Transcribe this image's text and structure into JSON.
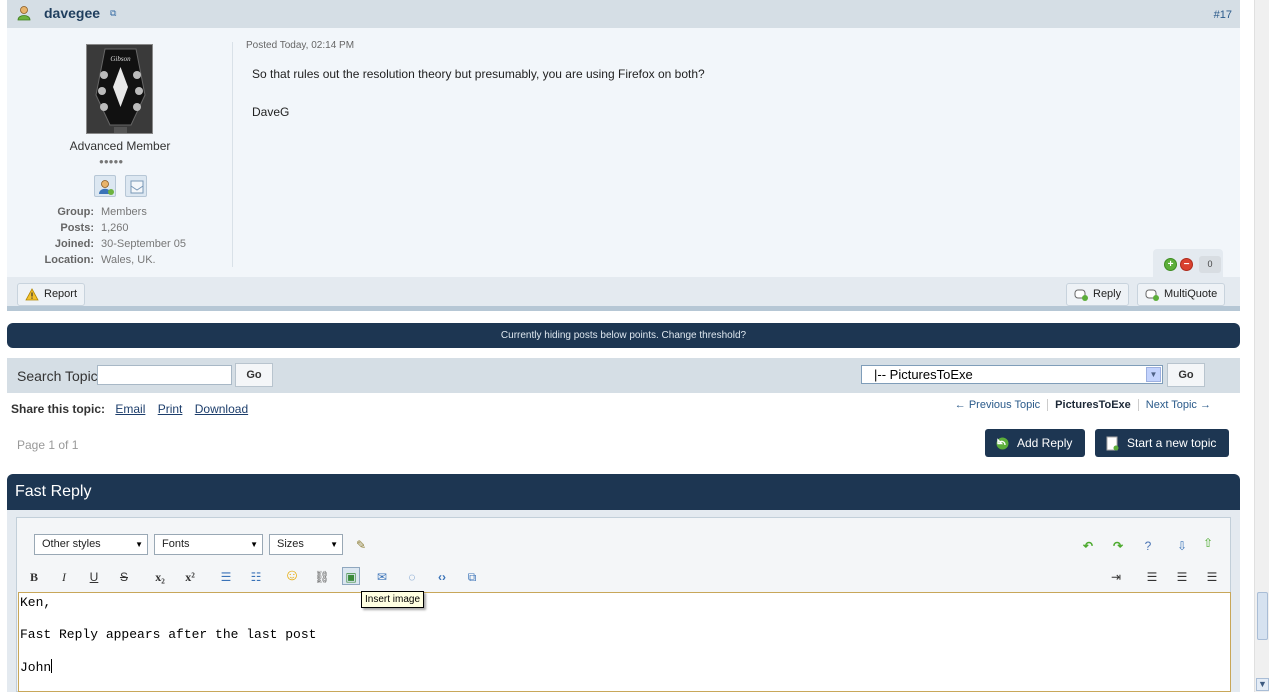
{
  "post": {
    "username": "davegee",
    "post_number": "#17",
    "posted": "Posted Today, 02:14 PM",
    "body_lines": [
      "So that rules out the resolution theory but presumably, you are using Firefox on both?",
      "DaveG"
    ],
    "author": {
      "title": "Advanced Member",
      "pips": "●●●●●",
      "meta": [
        {
          "k": "Group:",
          "v": "Members"
        },
        {
          "k": "Posts:",
          "v": "1,260"
        },
        {
          "k": "Joined:",
          "v": "30-September 05"
        },
        {
          "k": "Location:",
          "v": "Wales, UK."
        }
      ]
    },
    "rep_count": "0",
    "report_label": "Report",
    "reply_label": "Reply",
    "multiquote_label": "MultiQuote"
  },
  "threshold_text": "Currently hiding posts below points. Change threshold?",
  "topic_bar": {
    "search_label": "Search Topic",
    "search_value": "",
    "go_label": "Go",
    "forum_select": "|-- PicturesToExe"
  },
  "share": {
    "label": "Share this topic:",
    "links": [
      "Email",
      "Print",
      "Download"
    ]
  },
  "topic_nav": {
    "prev": "← Previous Topic",
    "current": "PicturesToExe",
    "next": "Next Topic →"
  },
  "page_info": "Page 1 of 1",
  "buttons": {
    "add_reply": "Add Reply",
    "new_topic": "Start a new topic"
  },
  "fast_reply": {
    "title": "Fast Reply",
    "styles_select": "Other styles",
    "fonts_select": "Fonts",
    "sizes_select": "Sizes",
    "text_lines": [
      "Ken,",
      "",
      "Fast Reply appears after the last post",
      "",
      "John"
    ],
    "tooltip": "Insert image"
  },
  "colors": {
    "dark_blue": "#1d3652",
    "header_bg": "#d5dee5",
    "post_bg": "#f2f6fa"
  }
}
